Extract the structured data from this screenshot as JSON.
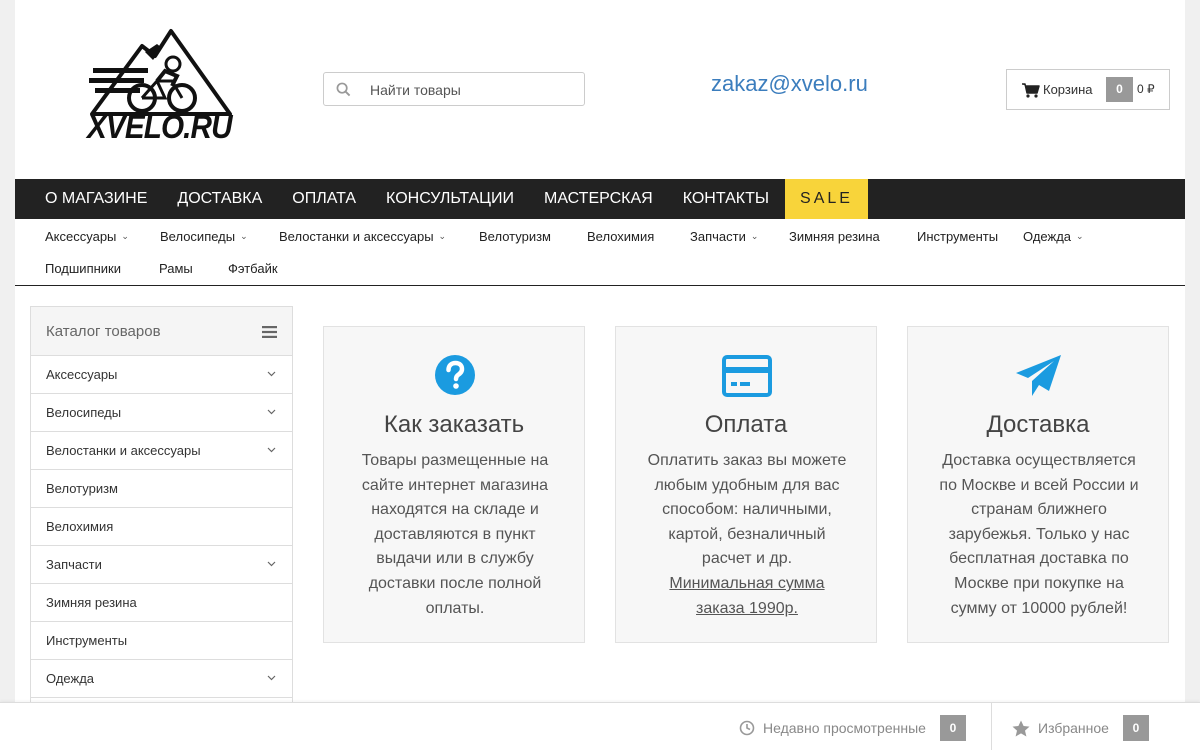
{
  "header": {
    "logo_text": "XVELO.RU",
    "search_placeholder": "Найти товары",
    "email": "zakaz@xvelo.ru",
    "cart": {
      "label": "Корзина",
      "count": "0",
      "sum": "0 ₽"
    }
  },
  "mainnav": {
    "items": [
      "О МАГАЗИНЕ",
      "ДОСТАВКА",
      "ОПЛАТА",
      "КОНСУЛЬТАЦИИ",
      "МАСТЕРСКАЯ",
      "КОНТАКТЫ"
    ],
    "sale": "SALE"
  },
  "subnav": {
    "items": [
      {
        "label": "Аксессуары",
        "dropdown": true
      },
      {
        "label": "Велосипеды",
        "dropdown": true
      },
      {
        "label": "Велостанки и аксессуары",
        "dropdown": true
      },
      {
        "label": "Велотуризм",
        "dropdown": false
      },
      {
        "label": "Велохимия",
        "dropdown": false
      },
      {
        "label": "Запчасти",
        "dropdown": true
      },
      {
        "label": "Зимняя резина",
        "dropdown": false
      },
      {
        "label": "Инструменты",
        "dropdown": false
      },
      {
        "label": "Одежда",
        "dropdown": true
      },
      {
        "label": "Подшипники",
        "dropdown": false
      },
      {
        "label": "Рамы",
        "dropdown": false
      },
      {
        "label": "Фэтбайк",
        "dropdown": false
      }
    ]
  },
  "sidebar": {
    "title": "Каталог товаров",
    "items": [
      {
        "label": "Аксессуары",
        "dropdown": true
      },
      {
        "label": "Велосипеды",
        "dropdown": true
      },
      {
        "label": "Велостанки и аксессуары",
        "dropdown": true
      },
      {
        "label": "Велотуризм",
        "dropdown": false
      },
      {
        "label": "Велохимия",
        "dropdown": false
      },
      {
        "label": "Запчасти",
        "dropdown": true
      },
      {
        "label": "Зимняя резина",
        "dropdown": false
      },
      {
        "label": "Инструменты",
        "dropdown": false
      },
      {
        "label": "Одежда",
        "dropdown": true
      }
    ]
  },
  "cards": [
    {
      "icon": "question-circle-icon",
      "title": "Как заказать",
      "text": [
        "Товары размещенные на",
        "сайте интернет магазина",
        "находятся на складе и",
        "доставляются в пункт",
        "выдачи или в службу",
        "доставки после полной",
        "оплаты."
      ]
    },
    {
      "icon": "credit-card-icon",
      "title": "Оплата",
      "text": [
        "Оплатить заказ вы можете",
        "любым удобным для вас",
        "способом: наличными,",
        "картой, безналичный",
        "расчет и др."
      ],
      "link": [
        "Минимальная сумма",
        "заказа 1990р."
      ]
    },
    {
      "icon": "paper-plane-icon",
      "title": "Доставка",
      "text": [
        "Доставка осуществляется",
        "по Москве и всей России и",
        "странам ближнего",
        "зарубежья. Только у нас",
        "бесплатная доставка по",
        "Москве при покупке на",
        "сумму от 10000 рублей!"
      ]
    }
  ],
  "footbar": {
    "recent_label": "Недавно просмотренные",
    "recent_count": "0",
    "fav_label": "Избранное",
    "fav_count": "0"
  },
  "colors": {
    "accent": "#1b9be0",
    "sale": "#f8d43a",
    "nav_bg": "#222222",
    "email": "#3b7dbd"
  }
}
